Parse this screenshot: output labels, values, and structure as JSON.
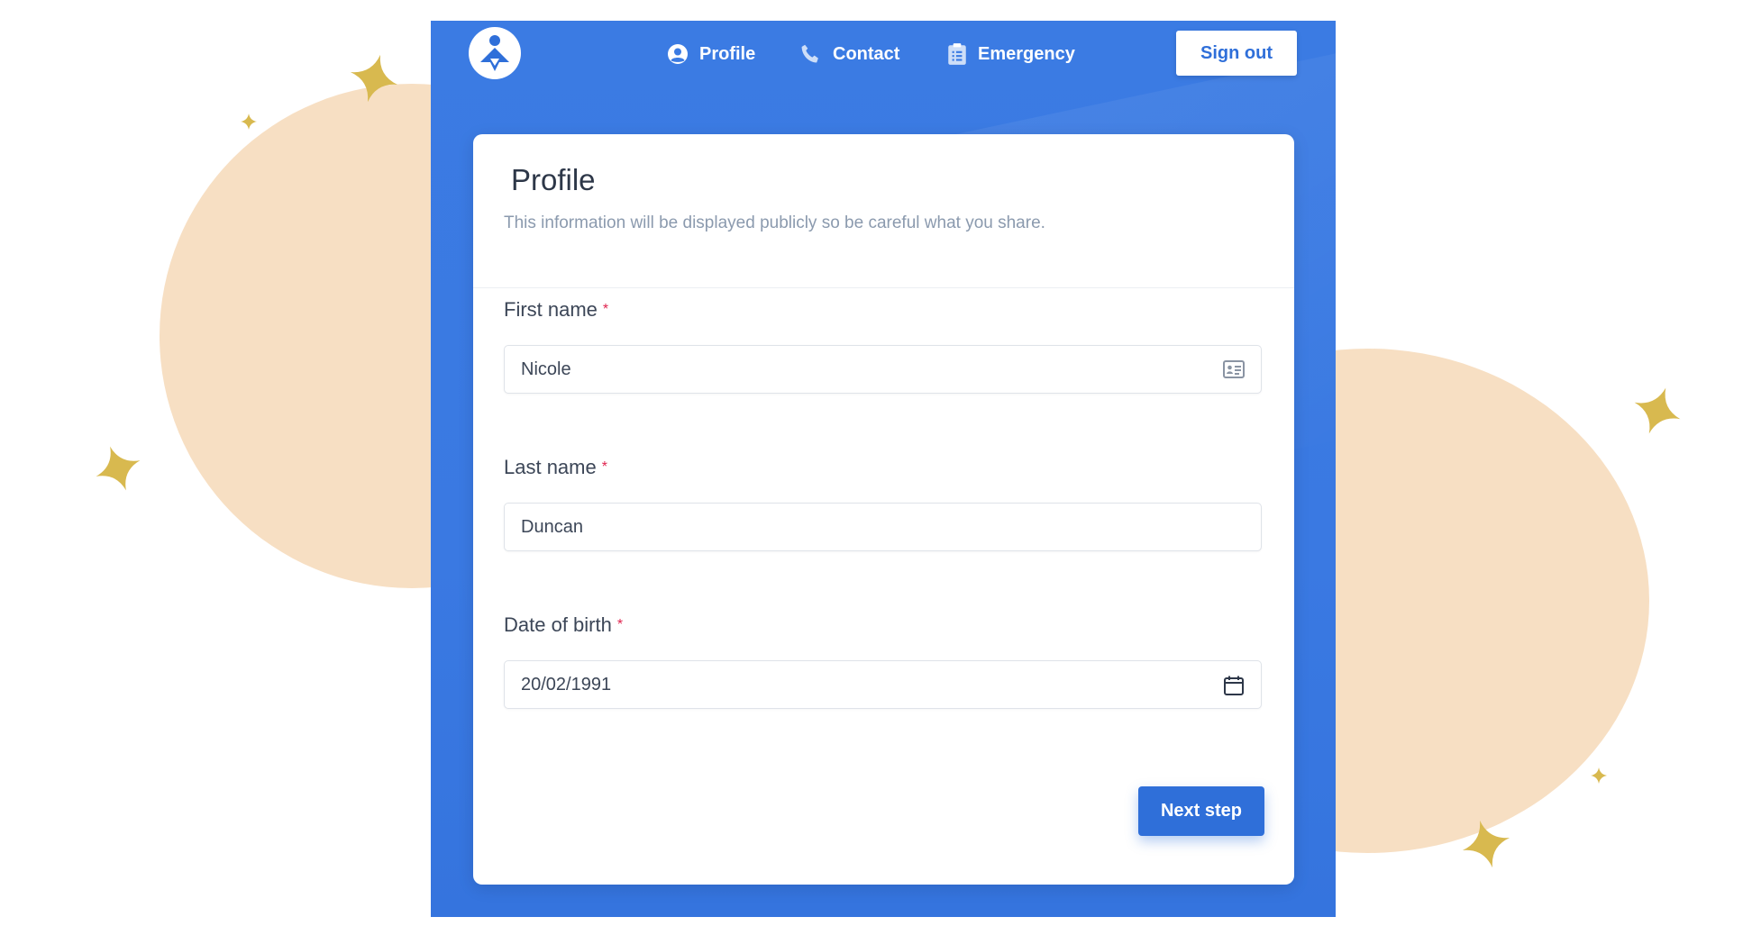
{
  "nav": {
    "logo_icon": "person-logo-icon",
    "items": [
      {
        "label": "Profile",
        "icon": "user-circle-icon"
      },
      {
        "label": "Contact",
        "icon": "phone-icon"
      },
      {
        "label": "Emergency",
        "icon": "clipboard-icon"
      }
    ],
    "sign_out_label": "Sign out"
  },
  "card": {
    "title": "Profile",
    "subtitle": "This information will be displayed publicly so be careful what you share.",
    "fields": [
      {
        "label": "First name",
        "required_mark": "*",
        "value": "Nicole",
        "icon": "id-card-icon"
      },
      {
        "label": "Last name",
        "required_mark": "*",
        "value": "Duncan"
      },
      {
        "label": "Date of birth",
        "required_mark": "*",
        "value": "20/02/1991",
        "icon": "calendar-icon"
      }
    ],
    "next_label": "Next step"
  },
  "colors": {
    "primary": "#2f6fd9",
    "app_background": "#3b7be3",
    "blob": "#f7dfc3",
    "sparkle": "#d8b94f",
    "required": "#e0244f"
  }
}
